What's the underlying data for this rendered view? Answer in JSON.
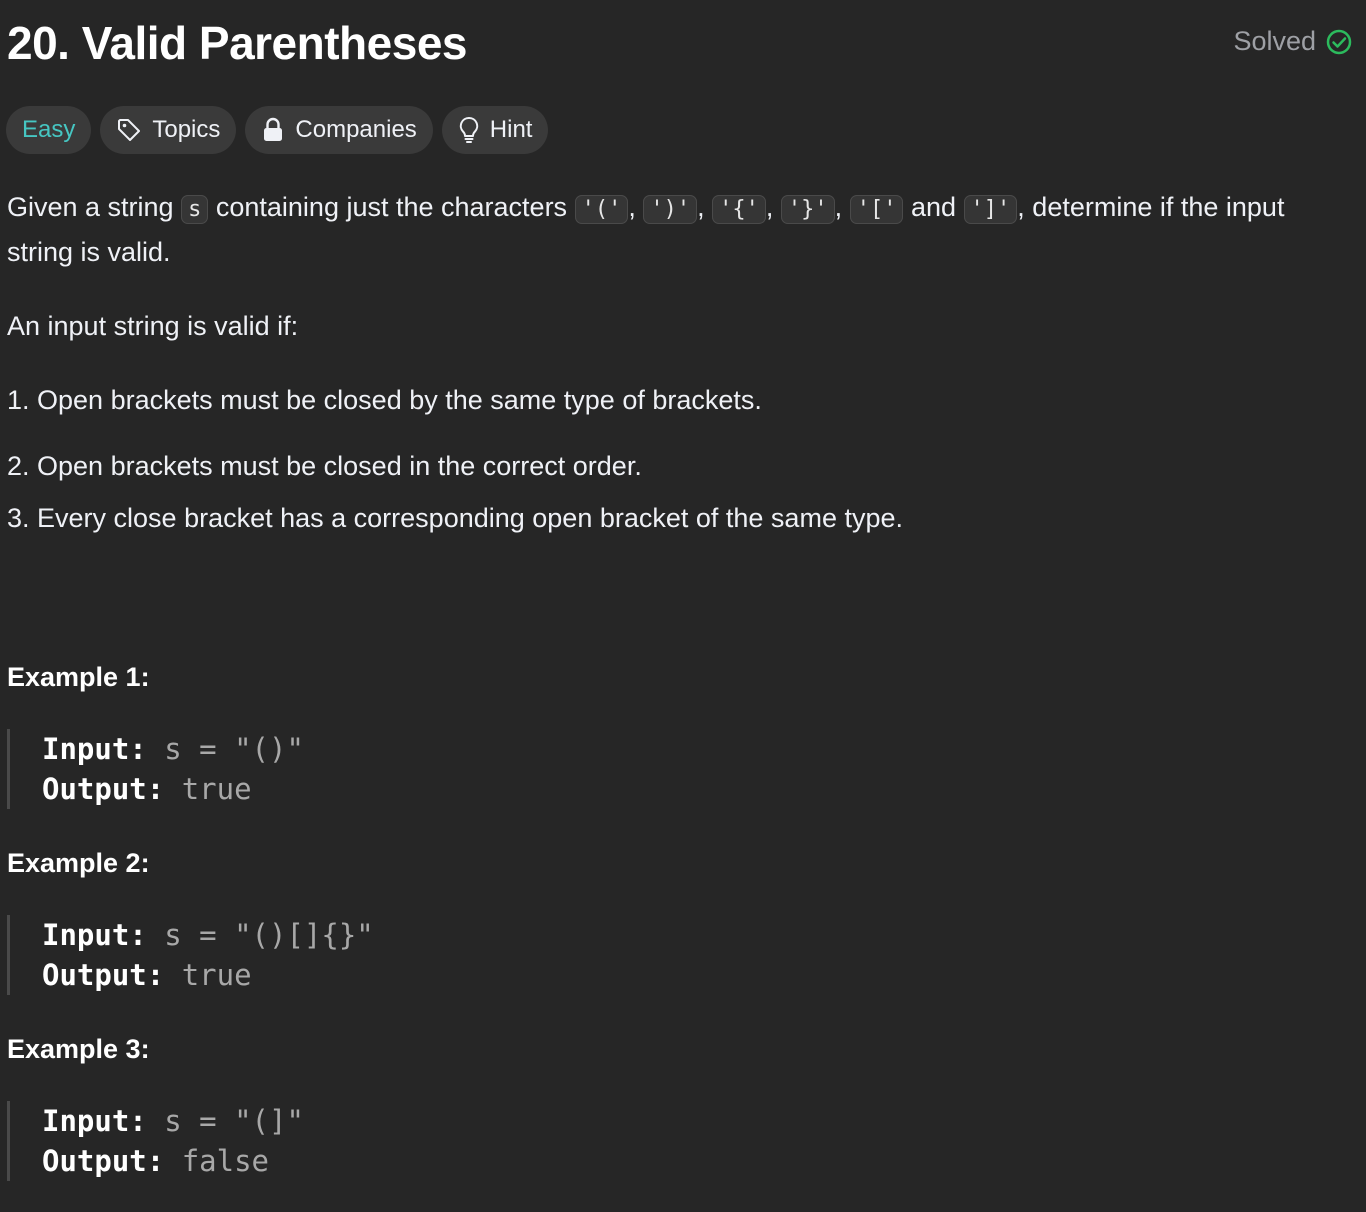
{
  "problem": {
    "title": "20. Valid Parentheses",
    "status_label": "Solved",
    "colors": {
      "accent_easy": "#46c6c2",
      "solved_green": "#2cbb5d"
    }
  },
  "tags": {
    "difficulty": "Easy",
    "topics": "Topics",
    "companies": "Companies",
    "hint": "Hint"
  },
  "description": {
    "p1_prefix": "Given a string",
    "p1_var": "s",
    "p1_mid": "containing just the characters",
    "chars": [
      "'('",
      "')'",
      "'{'",
      "'}'",
      "'['",
      "']'"
    ],
    "sep_comma": ",",
    "and": "and",
    "p1_suffix": ", determine if the input string is valid.",
    "p2": "An input string is valid if:",
    "rules": [
      "1. Open brackets must be closed by the same type of brackets.",
      "2. Open brackets must be closed in the correct order.",
      "3. Every close bracket has a corresponding open bracket of the same type."
    ]
  },
  "examples": [
    {
      "title": "Example 1:",
      "input_label": "Input:",
      "input": "s = \"()\"",
      "output_label": "Output:",
      "output": "true"
    },
    {
      "title": "Example 2:",
      "input_label": "Input:",
      "input": "s = \"()[]{}\"",
      "output_label": "Output:",
      "output": "true"
    },
    {
      "title": "Example 3:",
      "input_label": "Input:",
      "input": "s = \"(]\"",
      "output_label": "Output:",
      "output": "false"
    }
  ]
}
